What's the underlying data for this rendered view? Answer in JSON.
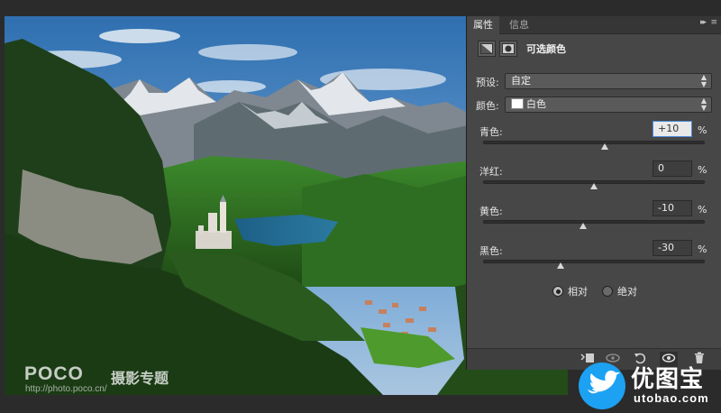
{
  "tabs": {
    "properties": "属性",
    "info": "信息",
    "collapse_glyph": "▸▸",
    "menu_glyph": "≡"
  },
  "adjustment": {
    "title": "可选颜色",
    "icons": [
      "adjustment-layer-icon",
      "mask-icon"
    ]
  },
  "preset": {
    "label": "预设:",
    "value": "自定"
  },
  "colors": {
    "label": "颜色:",
    "value": "白色",
    "swatch": "#ffffff"
  },
  "sliders": [
    {
      "label": "青色:",
      "value": "+10",
      "percent": 10,
      "active": true
    },
    {
      "label": "洋红:",
      "value": "0",
      "percent": 0,
      "active": false
    },
    {
      "label": "黄色:",
      "value": "-10",
      "percent": -10,
      "active": false
    },
    {
      "label": "黑色:",
      "value": "-30",
      "percent": -30,
      "active": false
    }
  ],
  "pct_symbol": "%",
  "method": {
    "relative": "相对",
    "absolute": "绝对",
    "selected": "relative"
  },
  "watermark": {
    "poco": "POCO",
    "poco_sub": "摄影专题",
    "url": "http://photo.poco.cn/"
  },
  "logo": {
    "name": "优图宝",
    "domain": "utobao.com"
  },
  "colors_theme": {
    "panel_bg": "#474747",
    "input_active_border": "#4b8ad6",
    "logo_blue": "#1da1f2"
  }
}
